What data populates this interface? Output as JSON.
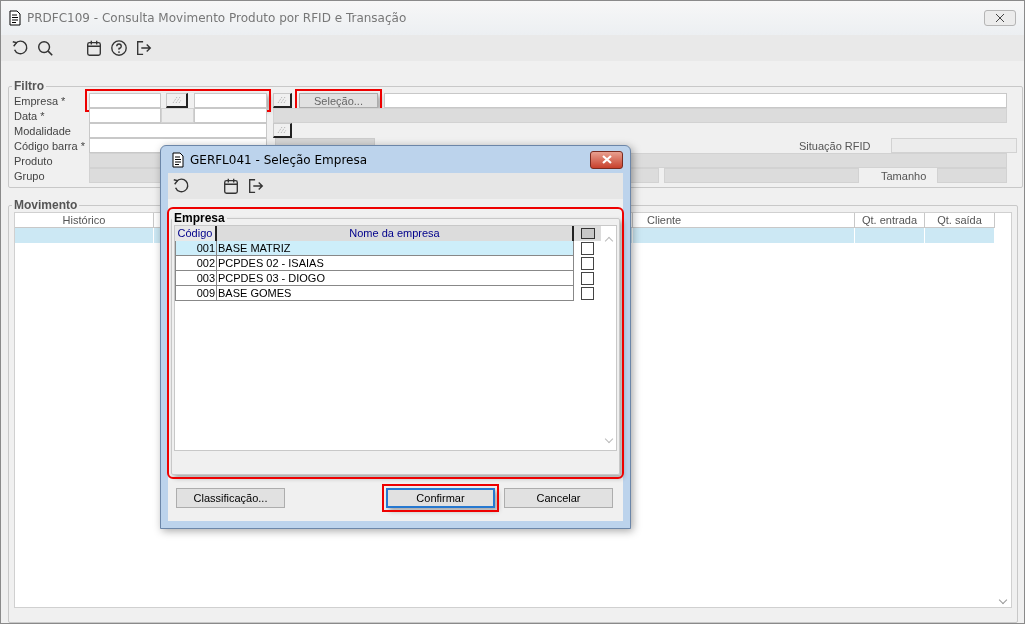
{
  "window": {
    "title": "PRDFC109 - Consulta Movimento Produto por RFID e Transação"
  },
  "toolbar": [
    {
      "kind": "refresh"
    },
    {
      "kind": "search"
    },
    {
      "kind": "calendar"
    },
    {
      "kind": "help"
    },
    {
      "kind": "exit"
    }
  ],
  "filter": {
    "title": "Filtro",
    "highlighted_empresa_fields": true,
    "rows": [
      {
        "kind": "empresa",
        "label": "Empresa *"
      },
      {
        "kind": "data",
        "label": "Data *"
      },
      {
        "kind": "modalidade",
        "label": "Modalidade"
      },
      {
        "kind": "codigo",
        "label": "Código barra *"
      },
      {
        "kind": "produto",
        "label": "Produto"
      },
      {
        "kind": "grupo",
        "label": "Grupo"
      }
    ],
    "selection_button": {
      "label": "Seleção...",
      "highlighted": true
    },
    "rfid_label": "Situação RFID",
    "size_label": "Tamanho"
  },
  "movement": {
    "title": "Movimento",
    "columns": [
      "Histórico",
      "Cliente",
      "Qt. entrada",
      "Qt. saída"
    ]
  },
  "dialog": {
    "title": "GERFL041 - Seleção Empresa",
    "toolbar": [
      {
        "kind": "refresh"
      },
      {
        "kind": "calendar"
      },
      {
        "kind": "exit"
      }
    ],
    "group": {
      "title": "Empresa",
      "highlighted": true,
      "columns": [
        "Código",
        "Nome da empresa"
      ],
      "select_all_indeterminate": true,
      "rows": [
        {
          "code": "001",
          "name": "BASE MATRIZ",
          "checked": false,
          "selected": true
        },
        {
          "code": "002",
          "name": "PCPDES 02 - ISAIAS",
          "checked": false,
          "selected": false
        },
        {
          "code": "003",
          "name": "PCPDES 03 - DIOGO",
          "checked": false,
          "selected": false
        },
        {
          "code": "009",
          "name": "BASE GOMES",
          "checked": false,
          "selected": false
        }
      ]
    },
    "buttons": [
      {
        "label": "Classificação...",
        "default": false,
        "highlighted": false
      },
      {
        "label": "Confirmar",
        "default": true,
        "highlighted": true
      },
      {
        "label": "Cancelar",
        "default": false,
        "highlighted": false
      }
    ]
  }
}
